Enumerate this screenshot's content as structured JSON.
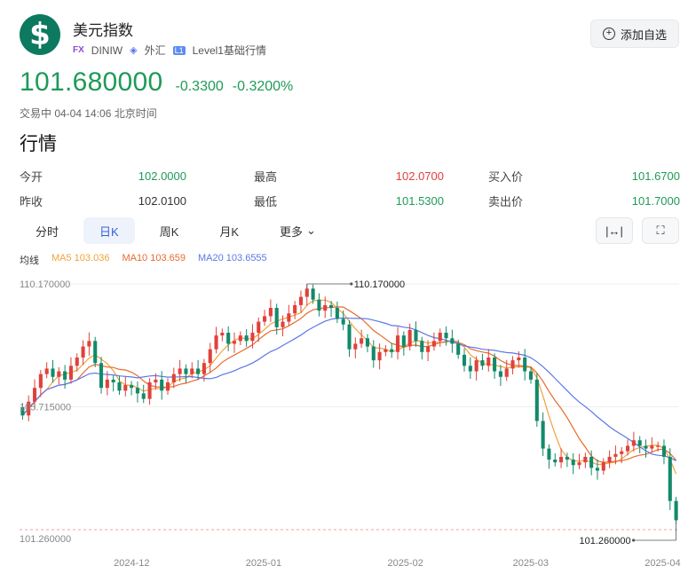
{
  "header": {
    "logo_glyph": "$",
    "title": "美元指数",
    "tag_fx": "FX",
    "code": "DINIW",
    "market_icon": "exchange-icon",
    "market": "外汇",
    "level_badge": "L1",
    "level_text": "Level1基础行情",
    "watch_label": "添加自选"
  },
  "quote": {
    "price": "101.680000",
    "change": "-0.3300",
    "change_pct": "-0.3200%",
    "status": "交易中 04-04 14:06 北京时间"
  },
  "section_title": "行情",
  "stats": {
    "open_label": "今开",
    "open": "102.0000",
    "high_label": "最高",
    "high": "102.0700",
    "bid_label": "买入价",
    "bid": "101.6700",
    "prev_label": "昨收",
    "prev": "102.0100",
    "low_label": "最低",
    "low": "101.5300",
    "ask_label": "卖出价",
    "ask": "101.7000"
  },
  "tabs": {
    "t1": "分时",
    "t2": "日K",
    "t3": "周K",
    "t4": "月K",
    "t5": "更多",
    "active": "日K"
  },
  "tools": {
    "fit_icon": "fit-width-icon",
    "fullscreen_icon": "fullscreen-icon"
  },
  "ma_legend": {
    "label": "均线",
    "ma5": "MA5 103.036",
    "ma10": "MA10 103.659",
    "ma20": "MA20 103.6555"
  },
  "colors": {
    "up": "#e0413b",
    "down": "#128a6a",
    "ma5": "#f2a23a",
    "ma10": "#e86a30",
    "ma20": "#5b78e8",
    "accent": "#3563d7"
  },
  "chart_data": {
    "type": "candlestick",
    "y_axis_labels": [
      "110.170000",
      "105.715000",
      "101.260000"
    ],
    "ylim": [
      101.26,
      110.17
    ],
    "x_ticks": [
      "2024-12",
      "2025-01",
      "2025-02",
      "2025-03",
      "2025-04"
    ],
    "max_annotation": "110.170000",
    "min_annotation": "101.260000",
    "closes": [
      105.4,
      105.9,
      106.4,
      106.9,
      107.1,
      106.8,
      107.0,
      106.7,
      107.2,
      107.5,
      107.9,
      108.1,
      107.3,
      106.4,
      106.7,
      106.6,
      106.3,
      106.5,
      106.4,
      106.2,
      106.0,
      106.6,
      106.7,
      106.3,
      106.6,
      106.9,
      107.1,
      106.9,
      107.1,
      106.9,
      107.3,
      107.8,
      108.3,
      108.4,
      108.0,
      108.1,
      108.3,
      108.1,
      108.4,
      108.8,
      109.0,
      109.3,
      108.6,
      108.8,
      109.1,
      109.4,
      109.7,
      110.0,
      109.6,
      109.2,
      109.4,
      109.3,
      108.9,
      108.7,
      107.8,
      108.0,
      108.2,
      107.9,
      107.4,
      107.7,
      107.8,
      107.7,
      108.3,
      107.9,
      108.5,
      108.1,
      107.7,
      107.9,
      108.1,
      108.4,
      108.2,
      108.0,
      107.6,
      107.2,
      107.0,
      107.4,
      107.2,
      107.5,
      107.0,
      106.8,
      107.1,
      107.4,
      107.5,
      107.0,
      106.7,
      105.2,
      104.2,
      103.8,
      103.7,
      103.9,
      103.8,
      103.6,
      103.7,
      103.9,
      103.5,
      103.4,
      103.7,
      103.9,
      104.0,
      104.1,
      104.3,
      104.5,
      104.3,
      104.2,
      104.3,
      104.3,
      103.9,
      102.3,
      101.6
    ]
  }
}
